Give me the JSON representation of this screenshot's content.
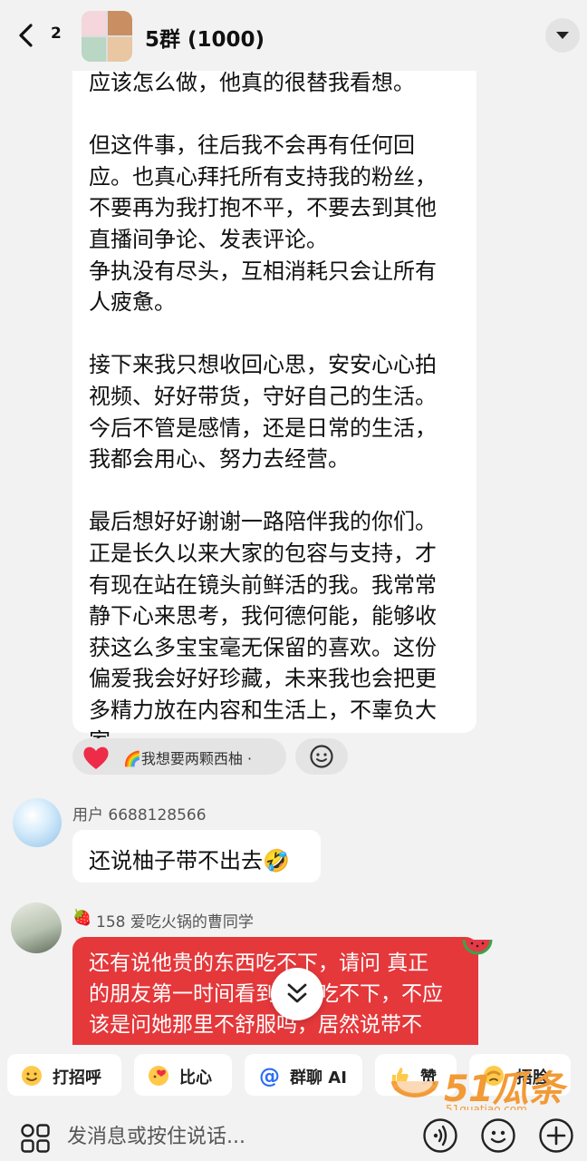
{
  "header": {
    "unread_count": "2",
    "title": "5群 (1000)"
  },
  "long_message": {
    "text": "应该怎么做，他真的很替我看想。\n\n但这件事，往后我不会再有任何回\n应。也真心拜托所有支持我的粉丝，\n不要再为我打抱不平，不要去到其他\n直播间争论、发表评论。\n争执没有尽头，互相消耗只会让所有\n人疲惫。\n\n接下来我只想收回心思，安安心心拍\n视频、好好带货，守好自己的生活。\n今后不管是感情，还是日常的生活，\n我都会用心、努力去经营。\n\n最后想好好谢谢一路陪伴我的你们。\n正是长久以来大家的包容与支持，才\n有现在站在镜头前鲜活的我。我常常\n静下心来思考，我何德何能，能够收\n获这么多宝宝毫无保留的喜欢。这份\n偏爱我会好好珍藏，未来我也会把更\n多精力放在内容和生活上，不辜负大\n家。"
  },
  "reaction": {
    "text": "🌈我想要两颗西柚 ·"
  },
  "messages": [
    {
      "sender": "用户 6688128566",
      "text": "还说柚子带不出去🤣"
    },
    {
      "sender_badge": "🍓",
      "sender": "158 爱吃火锅的曹同学",
      "text": "还有说他贵的东西吃不下，请问 真正\n的朋友第一时间看到别人吃不下，不应\n该是问她那里不舒服吗，居然说带不"
    }
  ],
  "quick_actions": [
    {
      "label": "打招呼",
      "icon": "wave-emoji-icon"
    },
    {
      "label": "比心",
      "icon": "heart-hand-emoji-icon"
    },
    {
      "label": "群聊 AI",
      "icon": "at-icon"
    },
    {
      "label": "赞",
      "icon": "thumbs-up-emoji-icon"
    },
    {
      "label": "捂脸",
      "icon": "facepalm-emoji-icon"
    }
  ],
  "watermark": {
    "brand": "51瓜条",
    "domain": "51guatiao.com"
  },
  "input": {
    "placeholder": "发消息或按住说话..."
  },
  "colors": {
    "background": "#f2f2f2",
    "red_bubble": "#e5383b",
    "heart": "#ee2c4a",
    "at_blue": "#2d6df6",
    "brand_orange": "#f29a36"
  }
}
